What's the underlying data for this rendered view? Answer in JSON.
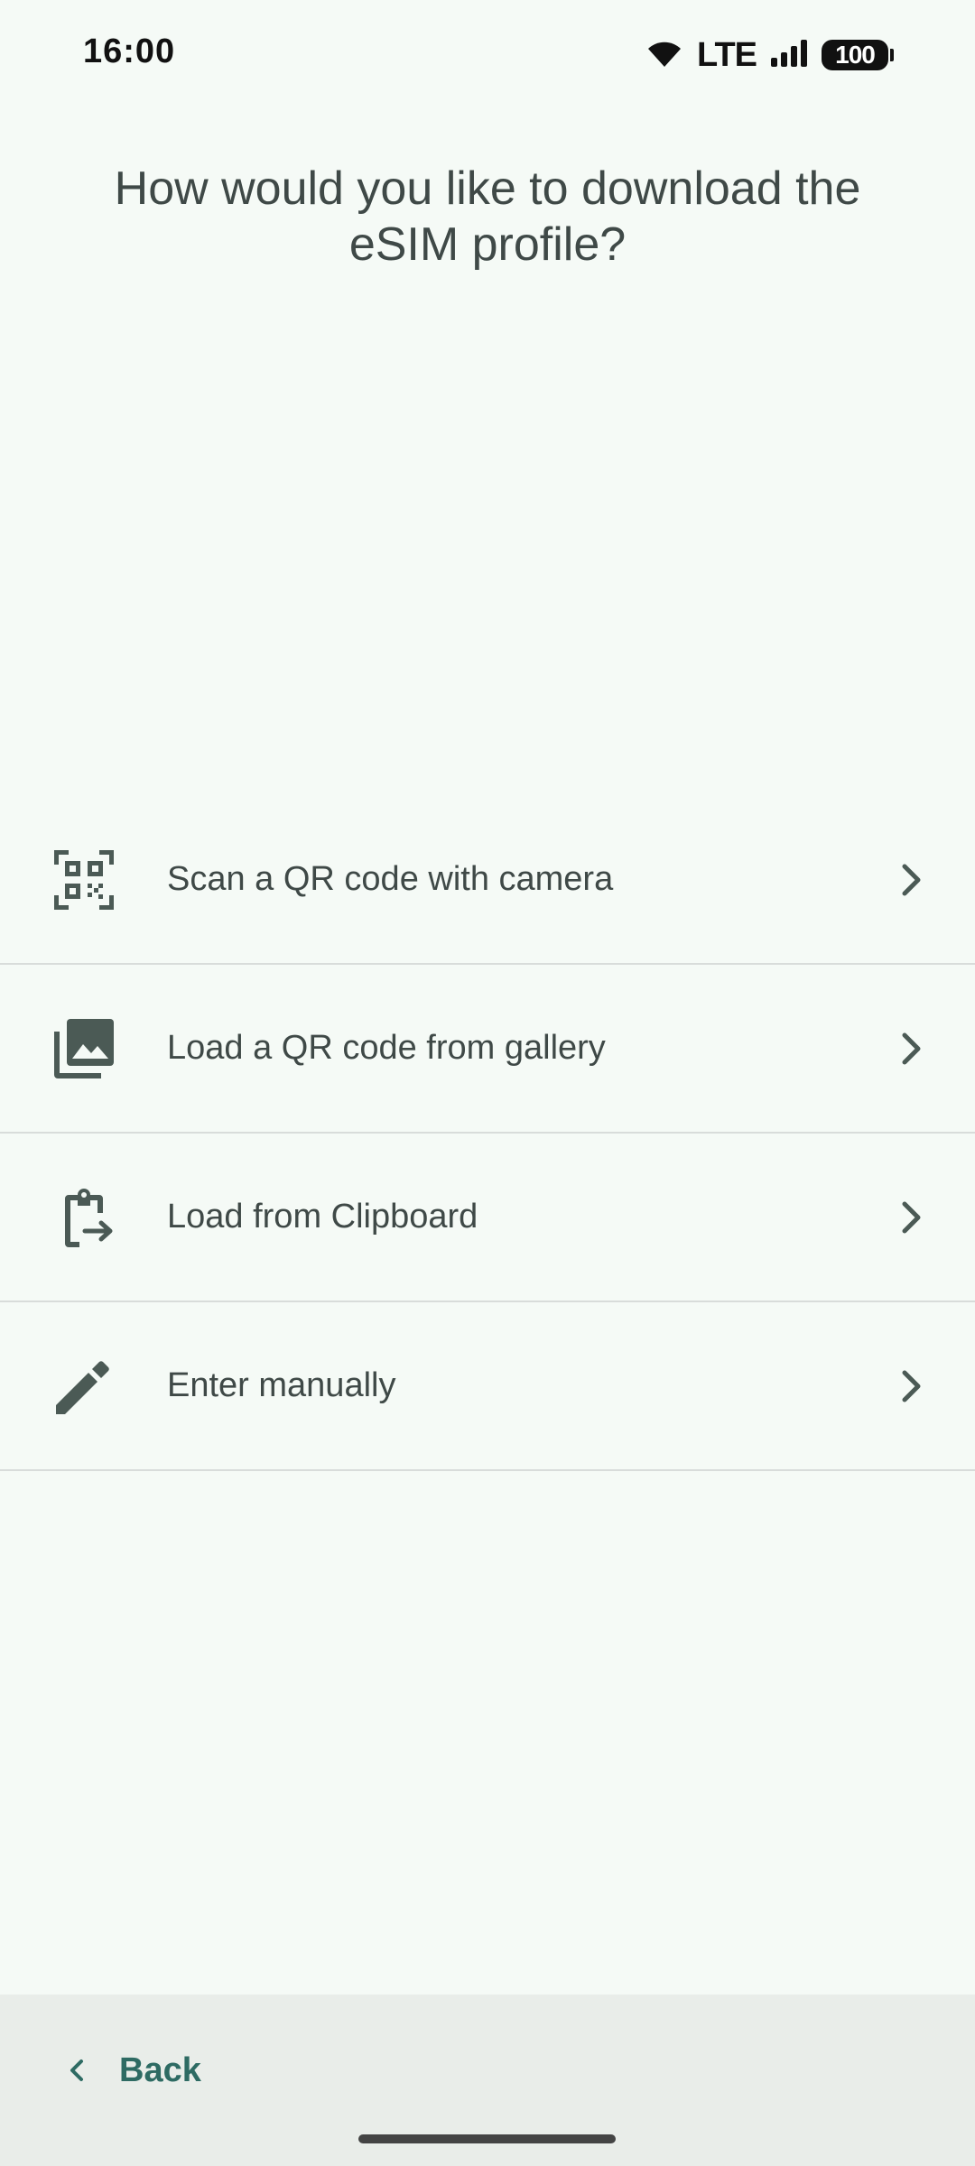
{
  "status_bar": {
    "time": "16:00",
    "network": "LTE",
    "battery": "100"
  },
  "title": "How would you like to download the eSIM profile?",
  "options": [
    {
      "label": "Scan a QR code with camera",
      "icon": "qr-scan-icon"
    },
    {
      "label": "Load a QR code from gallery",
      "icon": "gallery-icon"
    },
    {
      "label": "Load from Clipboard",
      "icon": "clipboard-icon"
    },
    {
      "label": "Enter manually",
      "icon": "pencil-icon"
    }
  ],
  "footer": {
    "back_label": "Back"
  },
  "colors": {
    "background": "#f5faf6",
    "text": "#3f4947",
    "icon": "#4b5a55",
    "accent": "#2e6b63",
    "bottom_bar": "#e9ede9",
    "divider": "#d8dcda"
  }
}
